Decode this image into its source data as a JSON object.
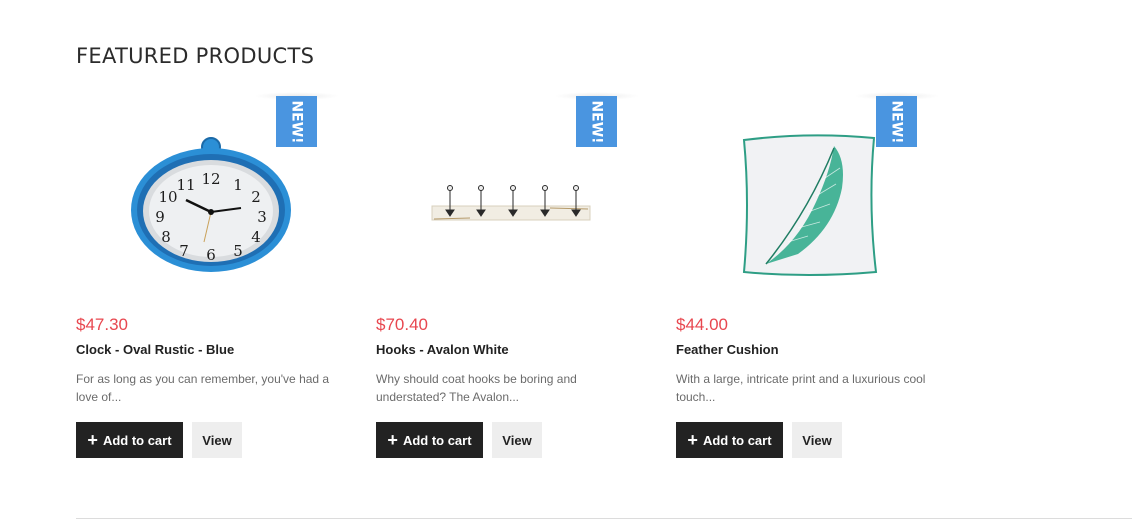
{
  "section": {
    "title": "FEATURED PRODUCTS"
  },
  "products": [
    {
      "badge": "NEW!",
      "price": "$47.30",
      "title": "Clock - Oval Rustic - Blue",
      "description": "For as long as you can remember, you've had a love of...",
      "add_to_cart": "Add to cart",
      "view": "View",
      "image_icon": "oval-clock-image"
    },
    {
      "badge": "NEW!",
      "price": "$70.40",
      "title": "Hooks - Avalon White",
      "description": "Why should coat hooks be boring and understated? The Avalon...",
      "add_to_cart": "Add to cart",
      "view": "View",
      "image_icon": "coat-hooks-image"
    },
    {
      "badge": "NEW!",
      "price": "$44.00",
      "title": "Feather Cushion",
      "description": "With a large, intricate print and a luxurious cool touch...",
      "add_to_cart": "Add to cart",
      "view": "View",
      "image_icon": "feather-cushion-image"
    }
  ],
  "colors": {
    "price": "#e8474f",
    "badge": "#4a95e0",
    "cart_button": "#222222",
    "view_button": "#eeeeee"
  }
}
